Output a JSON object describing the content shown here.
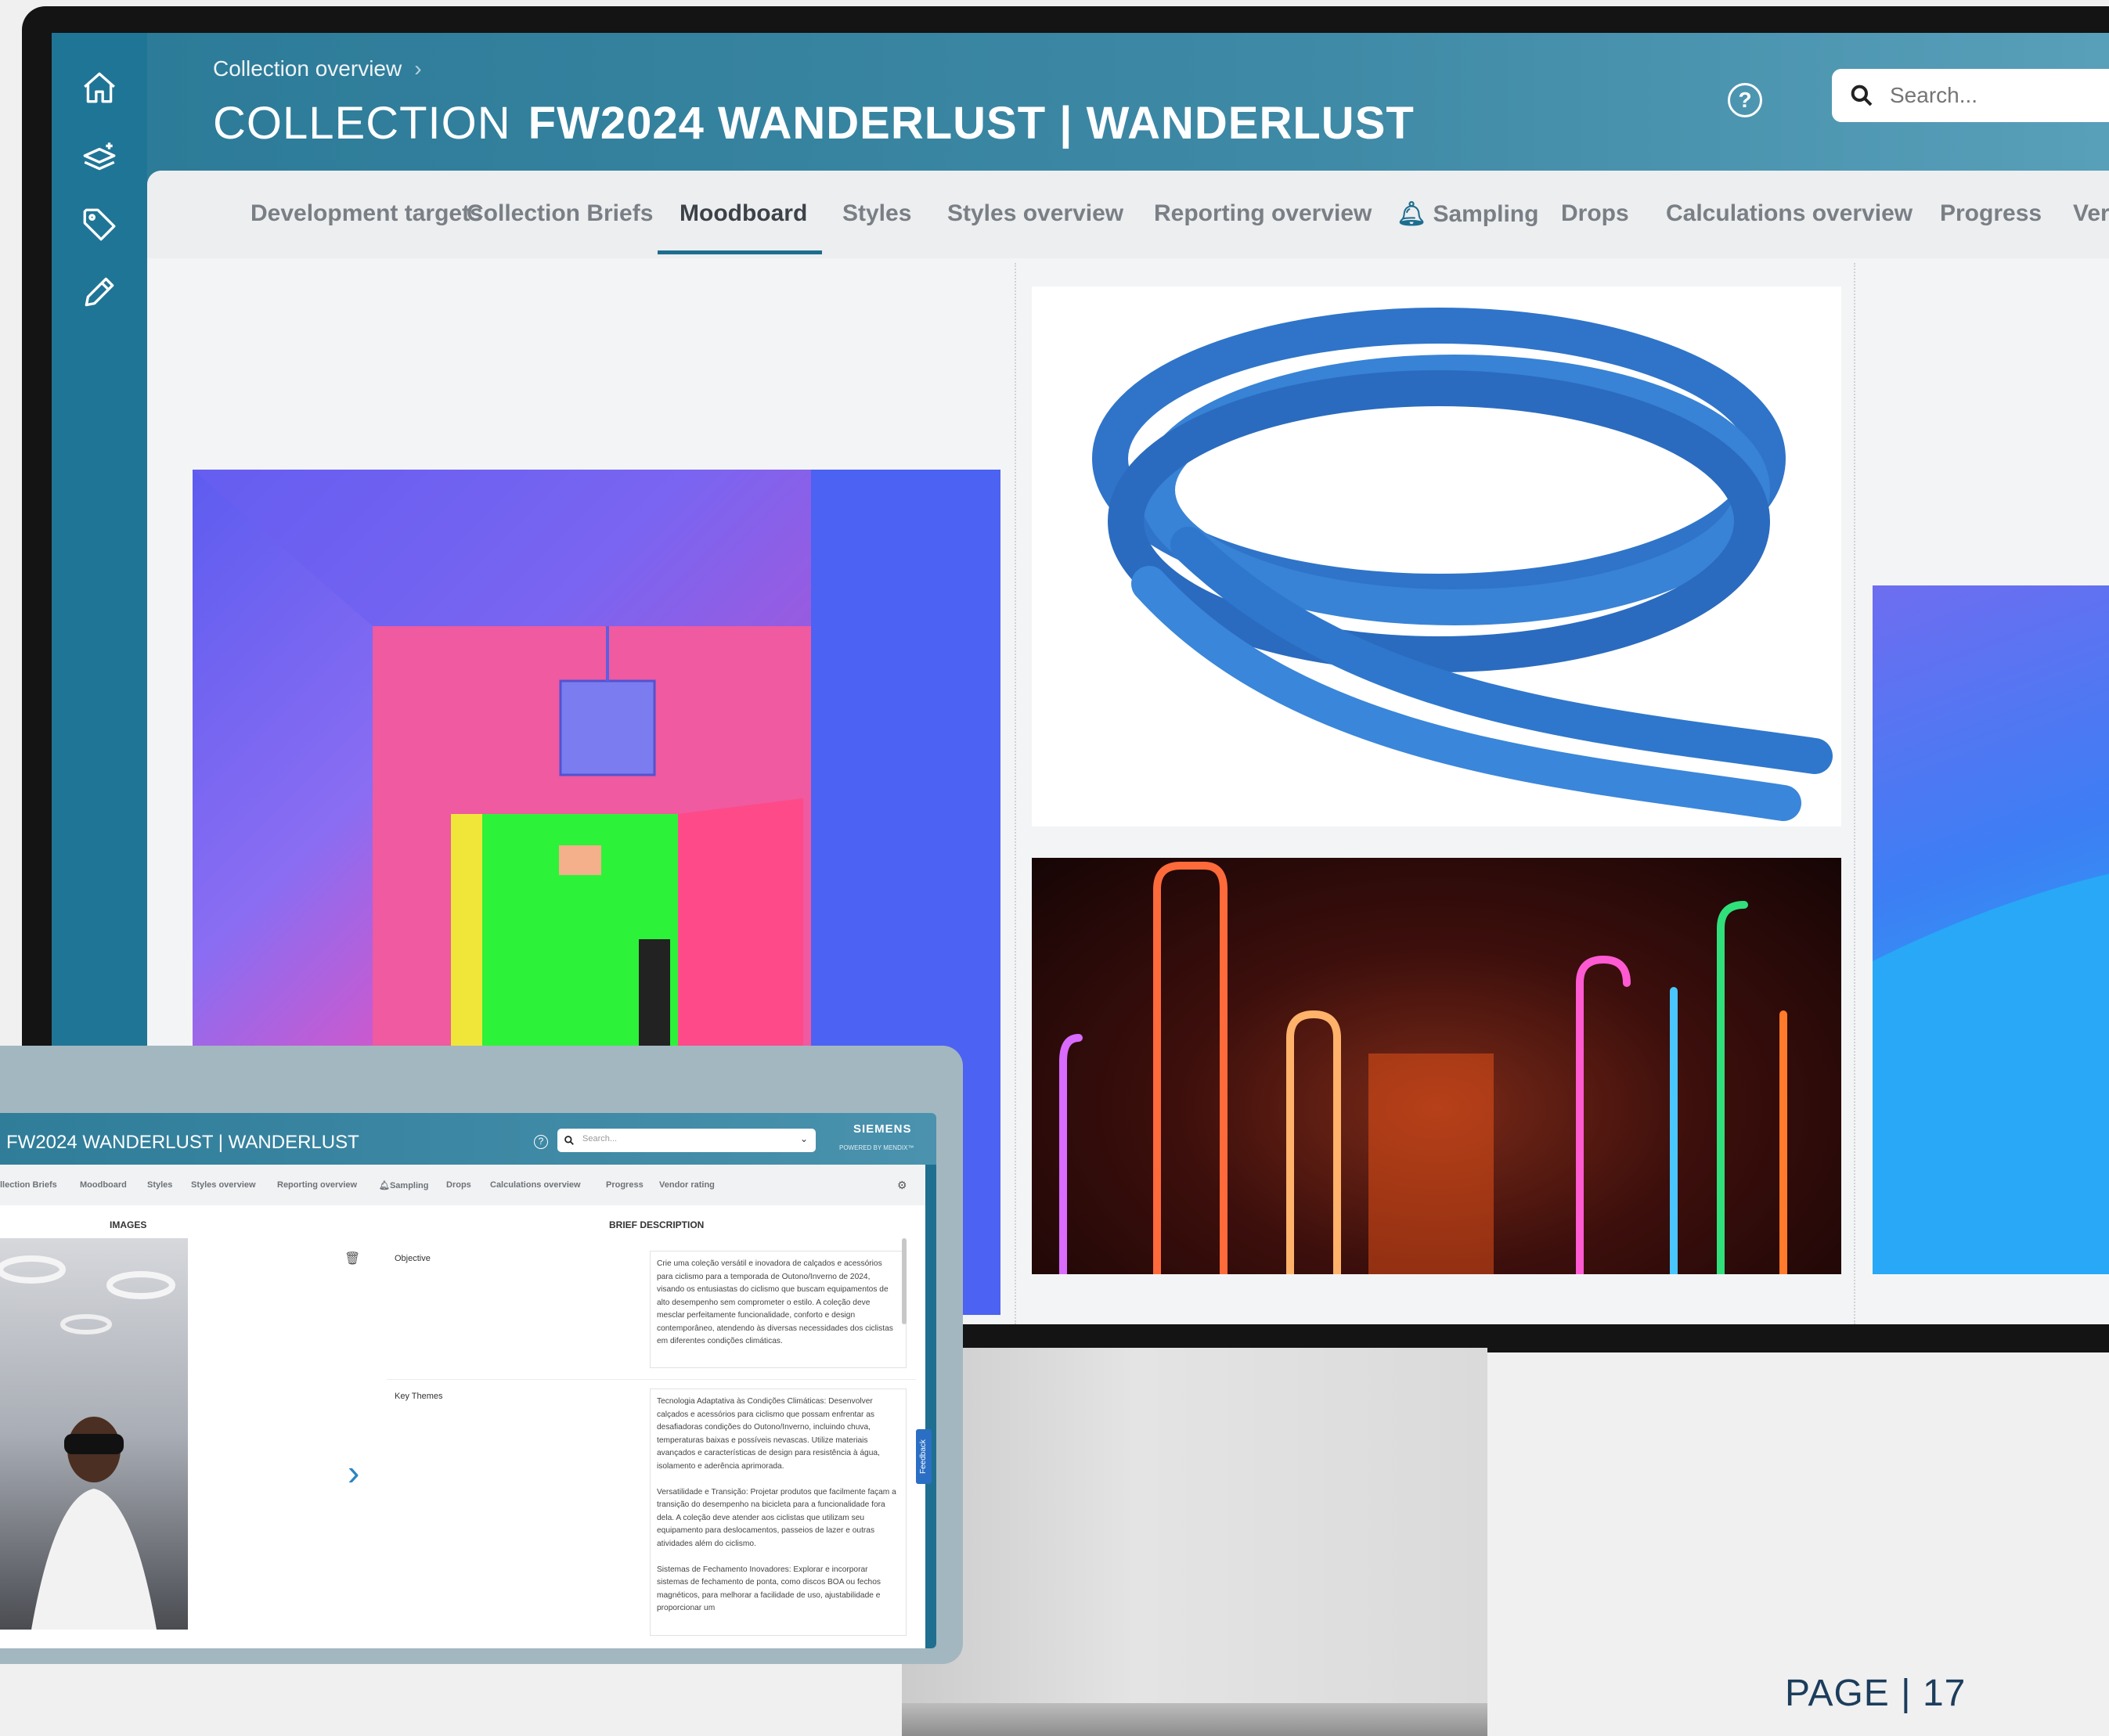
{
  "header": {
    "breadcrumb": "Collection overview",
    "breadcrumb_sep": "›",
    "title_prefix": "COLLECTION",
    "title_name": "FW2024 WANDERLUST | WANDERLUST",
    "help_icon": "?",
    "search_placeholder": "Search..."
  },
  "sidebar": {
    "items": [
      {
        "icon": "home-icon"
      },
      {
        "icon": "layers-add-icon"
      },
      {
        "icon": "tag-icon"
      },
      {
        "icon": "pencil-icon"
      }
    ]
  },
  "tabs": [
    {
      "label": "Development targets",
      "active": false
    },
    {
      "label": "Collection Briefs",
      "active": false
    },
    {
      "label": "Moodboard",
      "active": true
    },
    {
      "label": "Styles",
      "active": false
    },
    {
      "label": "Styles overview",
      "active": false
    },
    {
      "label": "Reporting overview",
      "active": false
    },
    {
      "label": "Sampling",
      "active": false,
      "icon": "bell-icon"
    },
    {
      "label": "Drops",
      "active": false
    },
    {
      "label": "Calculations overview",
      "active": false
    },
    {
      "label": "Progress",
      "active": false
    },
    {
      "label": "Ver",
      "active": false
    }
  ],
  "moodboard": {
    "images": [
      {
        "name": "neon-room-photo"
      },
      {
        "name": "blue-shoelace-photo"
      },
      {
        "name": "neon-tubes-photo"
      },
      {
        "name": "blue-gradient-photo"
      }
    ]
  },
  "tablet": {
    "title": "FW2024 WANDERLUST | WANDERLUST",
    "search_placeholder": "Search...",
    "brand": "SIEMENS",
    "powered_by": "POWERED BY MENDIX™",
    "tabs": [
      "llection Briefs",
      "Moodboard",
      "Styles",
      "Styles overview",
      "Reporting overview",
      "Sampling",
      "Drops",
      "Calculations overview",
      "Progress",
      "Vendor rating"
    ],
    "images_heading": "IMAGES",
    "brief_heading": "BRIEF DESCRIPTION",
    "feedback": "Feedback",
    "rows": [
      {
        "label": "Objective",
        "text": "Crie uma coleção versátil e inovadora de calçados e acessórios para ciclismo para a temporada de Outono/Inverno de 2024, visando os entusiastas do ciclismo que buscam equipamentos de alto desempenho sem comprometer o estilo. A coleção deve mesclar perfeitamente funcionalidade, conforto e design contemporâneo, atendendo às diversas necessidades dos ciclistas em diferentes condições climáticas."
      },
      {
        "label": "Key Themes",
        "text": "Tecnologia Adaptativa às Condições Climáticas: Desenvolver calçados e acessórios para ciclismo que possam enfrentar as desafiadoras condições do Outono/Inverno, incluindo chuva, temperaturas baixas e possíveis nevascas. Utilize materiais avançados e características de design para resistência à água, isolamento e aderência aprimorada.\n\nVersatilidade e Transição: Projetar produtos que facilmente façam a transição do desempenho na bicicleta para a funcionalidade fora dela. A coleção deve atender aos ciclistas que utilizam seu equipamento para deslocamentos, passeios de lazer e outras atividades além do ciclismo.\n\nSistemas de Fechamento Inovadores: Explorar e incorporar sistemas de fechamento de ponta, como discos BOA ou fechos magnéticos, para melhorar a facilidade de uso, ajustabilidade e proporcionar um"
      }
    ]
  },
  "footer": {
    "page_label": "PAGE | 17"
  }
}
